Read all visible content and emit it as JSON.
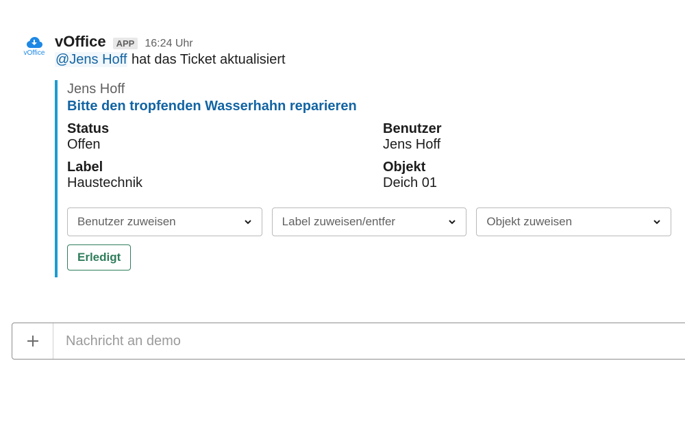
{
  "avatar": {
    "label": "vOffice"
  },
  "header": {
    "author": "vOffice",
    "app_badge": "APP",
    "timestamp": "16:24 Uhr"
  },
  "summary": {
    "mention": "@Jens Hoff",
    "text": " hat das Ticket aktualisiert"
  },
  "attachment": {
    "author": "Jens Hoff",
    "title": "Bitte den tropfenden Wasserhahn reparieren",
    "fields": {
      "left": [
        {
          "label": "Status",
          "value": "Offen"
        },
        {
          "label": "Label",
          "value": "Haustechnik"
        }
      ],
      "right": [
        {
          "label": "Benutzer",
          "value": "Jens Hoff"
        },
        {
          "label": "Objekt",
          "value": "Deich 01"
        }
      ]
    },
    "selects": [
      "Benutzer zuweisen",
      "Label zuweisen/entfer",
      "Objekt zuweisen"
    ],
    "done_label": "Erledigt"
  },
  "composer": {
    "placeholder": "Nachricht an demo"
  }
}
